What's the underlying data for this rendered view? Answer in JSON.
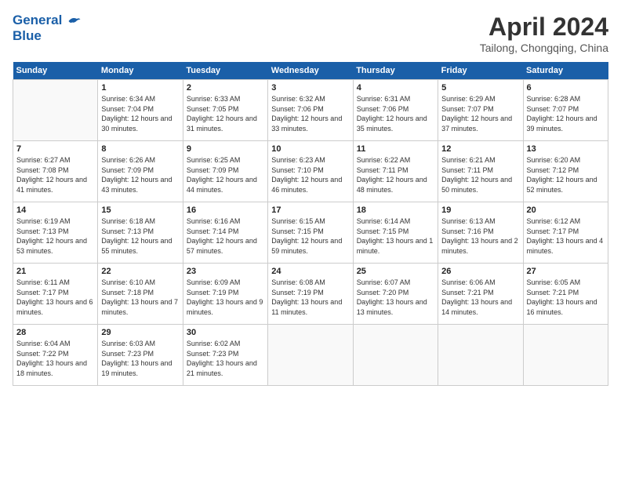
{
  "header": {
    "logo_line1": "General",
    "logo_line2": "Blue",
    "month_title": "April 2024",
    "subtitle": "Tailong, Chongqing, China"
  },
  "weekdays": [
    "Sunday",
    "Monday",
    "Tuesday",
    "Wednesday",
    "Thursday",
    "Friday",
    "Saturday"
  ],
  "weeks": [
    [
      {
        "day": "",
        "empty": true
      },
      {
        "day": "1",
        "sunrise": "6:34 AM",
        "sunset": "7:04 PM",
        "daylight": "12 hours and 30 minutes."
      },
      {
        "day": "2",
        "sunrise": "6:33 AM",
        "sunset": "7:05 PM",
        "daylight": "12 hours and 31 minutes."
      },
      {
        "day": "3",
        "sunrise": "6:32 AM",
        "sunset": "7:06 PM",
        "daylight": "12 hours and 33 minutes."
      },
      {
        "day": "4",
        "sunrise": "6:31 AM",
        "sunset": "7:06 PM",
        "daylight": "12 hours and 35 minutes."
      },
      {
        "day": "5",
        "sunrise": "6:29 AM",
        "sunset": "7:07 PM",
        "daylight": "12 hours and 37 minutes."
      },
      {
        "day": "6",
        "sunrise": "6:28 AM",
        "sunset": "7:07 PM",
        "daylight": "12 hours and 39 minutes."
      }
    ],
    [
      {
        "day": "7",
        "sunrise": "6:27 AM",
        "sunset": "7:08 PM",
        "daylight": "12 hours and 41 minutes."
      },
      {
        "day": "8",
        "sunrise": "6:26 AM",
        "sunset": "7:09 PM",
        "daylight": "12 hours and 43 minutes."
      },
      {
        "day": "9",
        "sunrise": "6:25 AM",
        "sunset": "7:09 PM",
        "daylight": "12 hours and 44 minutes."
      },
      {
        "day": "10",
        "sunrise": "6:23 AM",
        "sunset": "7:10 PM",
        "daylight": "12 hours and 46 minutes."
      },
      {
        "day": "11",
        "sunrise": "6:22 AM",
        "sunset": "7:11 PM",
        "daylight": "12 hours and 48 minutes."
      },
      {
        "day": "12",
        "sunrise": "6:21 AM",
        "sunset": "7:11 PM",
        "daylight": "12 hours and 50 minutes."
      },
      {
        "day": "13",
        "sunrise": "6:20 AM",
        "sunset": "7:12 PM",
        "daylight": "12 hours and 52 minutes."
      }
    ],
    [
      {
        "day": "14",
        "sunrise": "6:19 AM",
        "sunset": "7:13 PM",
        "daylight": "12 hours and 53 minutes."
      },
      {
        "day": "15",
        "sunrise": "6:18 AM",
        "sunset": "7:13 PM",
        "daylight": "12 hours and 55 minutes."
      },
      {
        "day": "16",
        "sunrise": "6:16 AM",
        "sunset": "7:14 PM",
        "daylight": "12 hours and 57 minutes."
      },
      {
        "day": "17",
        "sunrise": "6:15 AM",
        "sunset": "7:15 PM",
        "daylight": "12 hours and 59 minutes."
      },
      {
        "day": "18",
        "sunrise": "6:14 AM",
        "sunset": "7:15 PM",
        "daylight": "13 hours and 1 minute."
      },
      {
        "day": "19",
        "sunrise": "6:13 AM",
        "sunset": "7:16 PM",
        "daylight": "13 hours and 2 minutes."
      },
      {
        "day": "20",
        "sunrise": "6:12 AM",
        "sunset": "7:17 PM",
        "daylight": "13 hours and 4 minutes."
      }
    ],
    [
      {
        "day": "21",
        "sunrise": "6:11 AM",
        "sunset": "7:17 PM",
        "daylight": "13 hours and 6 minutes."
      },
      {
        "day": "22",
        "sunrise": "6:10 AM",
        "sunset": "7:18 PM",
        "daylight": "13 hours and 7 minutes."
      },
      {
        "day": "23",
        "sunrise": "6:09 AM",
        "sunset": "7:19 PM",
        "daylight": "13 hours and 9 minutes."
      },
      {
        "day": "24",
        "sunrise": "6:08 AM",
        "sunset": "7:19 PM",
        "daylight": "13 hours and 11 minutes."
      },
      {
        "day": "25",
        "sunrise": "6:07 AM",
        "sunset": "7:20 PM",
        "daylight": "13 hours and 13 minutes."
      },
      {
        "day": "26",
        "sunrise": "6:06 AM",
        "sunset": "7:21 PM",
        "daylight": "13 hours and 14 minutes."
      },
      {
        "day": "27",
        "sunrise": "6:05 AM",
        "sunset": "7:21 PM",
        "daylight": "13 hours and 16 minutes."
      }
    ],
    [
      {
        "day": "28",
        "sunrise": "6:04 AM",
        "sunset": "7:22 PM",
        "daylight": "13 hours and 18 minutes."
      },
      {
        "day": "29",
        "sunrise": "6:03 AM",
        "sunset": "7:23 PM",
        "daylight": "13 hours and 19 minutes."
      },
      {
        "day": "30",
        "sunrise": "6:02 AM",
        "sunset": "7:23 PM",
        "daylight": "13 hours and 21 minutes."
      },
      {
        "day": "",
        "empty": true
      },
      {
        "day": "",
        "empty": true
      },
      {
        "day": "",
        "empty": true
      },
      {
        "day": "",
        "empty": true
      }
    ]
  ],
  "labels": {
    "sunrise": "Sunrise:",
    "sunset": "Sunset:",
    "daylight": "Daylight:"
  }
}
